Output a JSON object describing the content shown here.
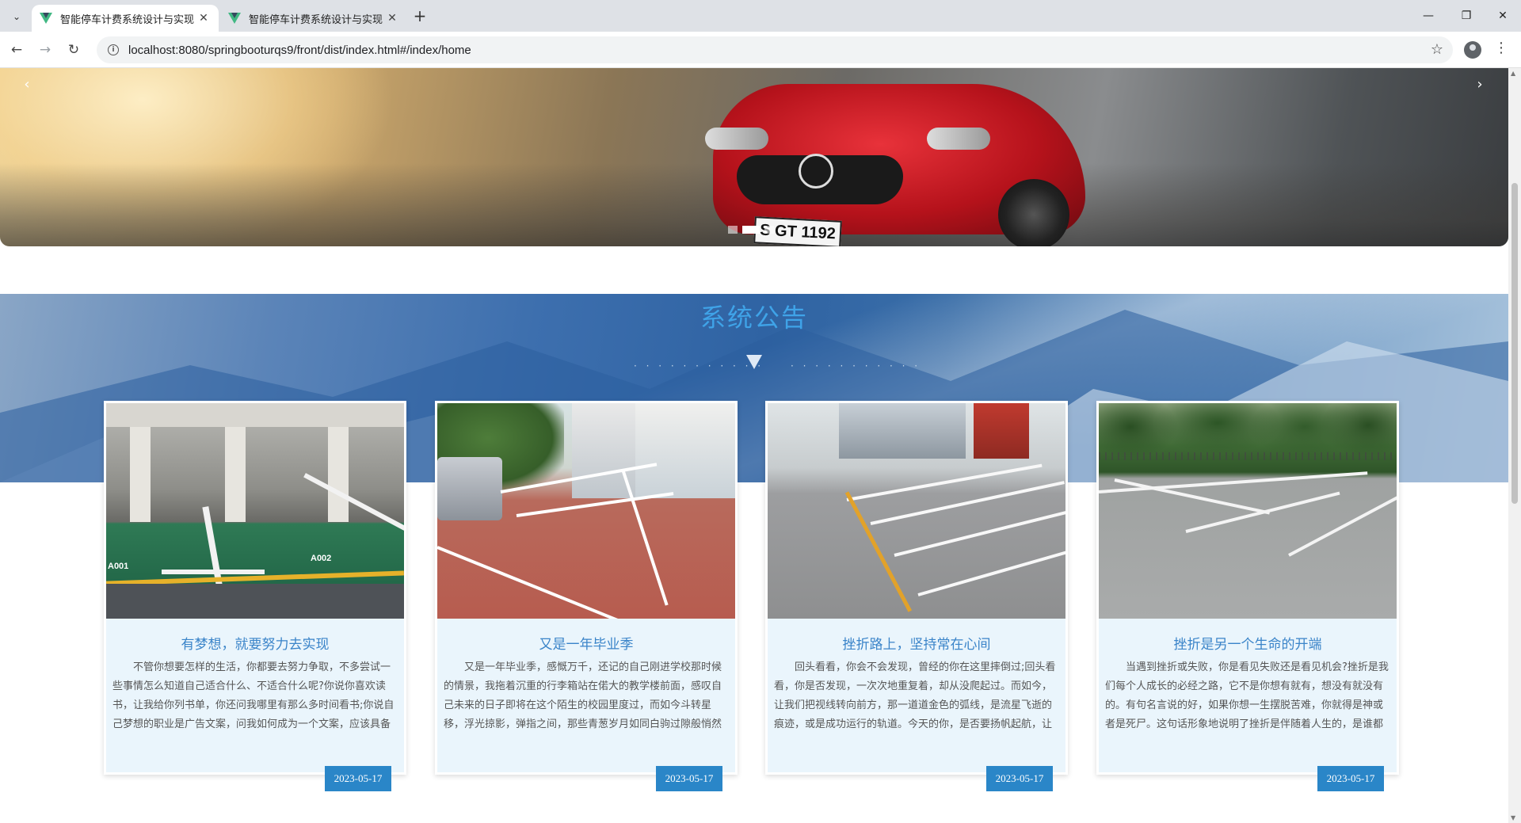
{
  "browser": {
    "tabs": [
      {
        "title": "智能停车计费系统设计与实现",
        "active": true
      },
      {
        "title": "智能停车计费系统设计与实现",
        "active": false
      }
    ],
    "url": "localhost:8080/springbooturqs9/front/dist/index.html#/index/home"
  },
  "banner": {
    "plate_text": "S GT 1192",
    "slide_count": 3,
    "active_slide": 2
  },
  "notice": {
    "title": "系统公告",
    "divider_dots": "· · · · · · · · · · ·",
    "cards": [
      {
        "title": "有梦想，就要努力去实现",
        "text": "不管你想要怎样的生活，你都要去努力争取，不多尝试一些事情怎么知道自己适合什么、不适合什么呢?你说你喜欢读书，让我给你列书单，你还问我哪里有那么多时间看书;你说自己梦想的职业是广告文案，问我如何成为一个文案，应该具备哪些素质;你说你计划晨跑，但总是因为学",
        "date": "2023-05-17",
        "labels": [
          "A001",
          "A002"
        ]
      },
      {
        "title": "又是一年毕业季",
        "text": "又是一年毕业季，感慨万千，还记的自己刚进学校那时候的情景，我拖着沉重的行李箱站在偌大的教学楼前面，感叹自己未来的日子即将在这个陌生的校园里度过，而如今斗转星移，浮光掠影，弹指之间，那些青葱岁月如同白驹过隙般悄然从指缝溜走。过去的种种在胸口交集纠结，像打翻的",
        "date": "2023-05-17"
      },
      {
        "title": "挫折路上，坚持常在心间",
        "text": "回头看看，你会不会发现，曾经的你在这里摔倒过;回头看看，你是否发现，一次次地重复着，却从没爬起过。而如今，让我们把视线转向前方，那一道道金色的弧线，是流星飞逝的痕迹，或是成功运行的轨道。今天的你，是否要扬帆起航，让幸福来敲门?清晨的太阳撒向大地，神奇的宇宙",
        "date": "2023-05-17"
      },
      {
        "title": "挫折是另一个生命的开端",
        "text": "当遇到挫折或失败，你是看见失败还是看见机会?挫折是我们每个人成长的必经之路，它不是你想有就有，想没有就没有的。有句名言说的好，如果你想一生摆脱苦难，你就得是神或者是死尸。这句话形象地说明了挫折是伴随着人生的，是谁都逃不掉的。",
        "date": "2023-05-17"
      }
    ]
  }
}
